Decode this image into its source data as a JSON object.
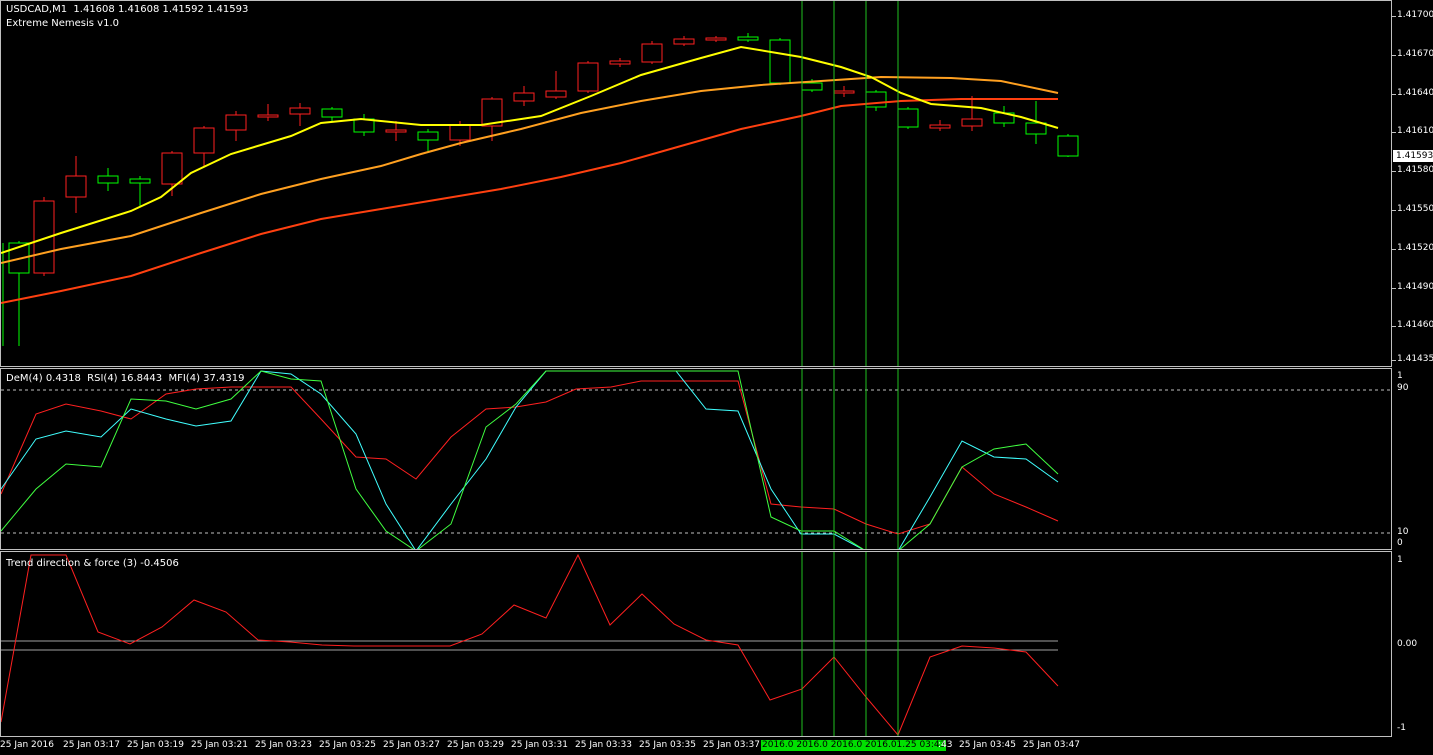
{
  "main": {
    "symbol_header": "USDCAD,M1  1.41608 1.41608 1.41592 1.41593",
    "indicator_name": "Extreme Nemesis v1.0",
    "current_price": "1.41593",
    "price_labels": [
      "1.41700",
      "1.41670",
      "1.41640",
      "1.41610",
      "1.41580",
      "1.41550",
      "1.41520",
      "1.41490",
      "1.41460",
      "1.41435"
    ]
  },
  "oscillator": {
    "header": "DeM(4) 0.4318  RSI(4) 16.8443  MFI(4) 37.4319",
    "levels": [
      "1",
      "90",
      "10",
      "0"
    ]
  },
  "trend": {
    "header": "Trend direction & force (3) -0.4506",
    "levels": [
      "1",
      "0.00",
      "-1"
    ]
  },
  "time_axis": {
    "labels": [
      "25 Jan 2016",
      "25 Jan 03:17",
      "25 Jan 03:19",
      "25 Jan 03:21",
      "25 Jan 03:23",
      "25 Jan 03:25",
      "25 Jan 03:27",
      "25 Jan 03:29",
      "25 Jan 03:31",
      "25 Jan 03:33",
      "25 Jan 03:35",
      "25 Jan 03:37",
      "25 Jan 03:43",
      "25 Jan 03:45",
      "25 Jan 03:47"
    ],
    "highlight": "2016.0  2016.0  2016.0  2016.01.25 03:43"
  },
  "colors": {
    "bull": "#00ff00",
    "bear": "#ff2020",
    "yellow": "#ffff00",
    "orange": "#ffa020",
    "red_ma": "#ff4010",
    "rsi": "#ff2020",
    "dem": "#40ffff",
    "mfi": "#40ff40"
  }
}
